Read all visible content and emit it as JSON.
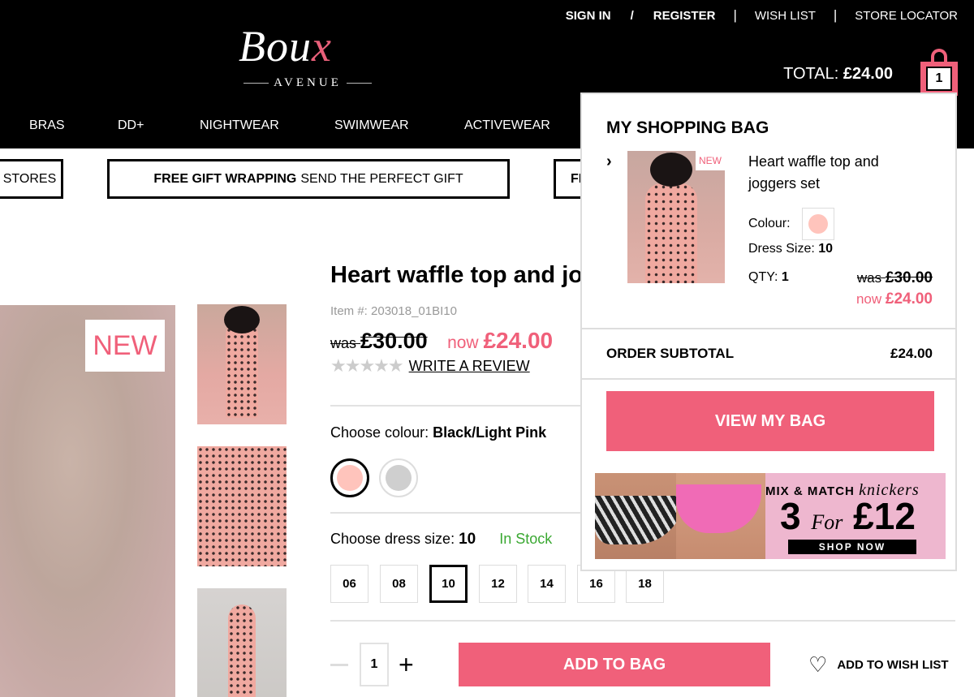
{
  "header": {
    "top_links": {
      "sign_in": "SIGN IN",
      "slash": "/",
      "register": "REGISTER",
      "sep": "|",
      "wish_list": "WISH LIST",
      "store_locator": "STORE LOCATOR"
    },
    "logo": {
      "brand": "Bou",
      "brand_x": "x",
      "sub": "AVENUE"
    },
    "total_label": "TOTAL:",
    "total_value": "£24.00",
    "bag_count": "1",
    "nav": [
      "BRAS",
      "DD+",
      "NIGHTWEAR",
      "SWIMWEAR",
      "ACTIVEWEAR"
    ]
  },
  "promos": [
    {
      "bold": "",
      "text": "STORES"
    },
    {
      "bold": "FREE GIFT WRAPPING",
      "text": "SEND THE PERFECT GIFT"
    },
    {
      "bold": "FI",
      "text": ""
    }
  ],
  "product": {
    "new_badge": "NEW",
    "title": "Heart waffle top and joggers set",
    "item_number": "Item #: 203018_01BI10",
    "was_label": "was",
    "was_price": "£30.00",
    "now_label": "now",
    "now_price": "£24.00",
    "stars": "★★★★★",
    "rating": 0,
    "review_link": "WRITE A REVIEW",
    "colour_label": "Choose colour:",
    "colour_value": "Black/Light Pink",
    "colours": [
      {
        "name": "Light Pink",
        "hex": "#ffc4bc",
        "selected": true
      },
      {
        "name": "Grey",
        "hex": "#cfcfcf",
        "selected": false
      }
    ],
    "size_label": "Choose dress size:",
    "size_value": "10",
    "stock_status": "In Stock",
    "sizes": [
      "06",
      "08",
      "10",
      "12",
      "14",
      "16",
      "18"
    ],
    "selected_size": "10",
    "quantity": "1",
    "minus": "—",
    "plus": "+",
    "add_to_bag": "ADD TO BAG",
    "wish_icon": "♡",
    "add_to_wish": "ADD TO WISH LIST"
  },
  "minibag": {
    "title": "MY SHOPPING BAG",
    "chevron": "›",
    "item": {
      "new_badge": "NEW",
      "name": "Heart waffle top and joggers set",
      "colour_label": "Colour:",
      "colour_hex": "#ffc4bc",
      "size_label": "Dress Size:",
      "size_value": "10",
      "qty_label": "QTY:",
      "qty_value": "1",
      "was_label": "was",
      "was_price": "£30.00",
      "now_label": "now",
      "now_price": "£24.00"
    },
    "subtotal_label": "ORDER SUBTOTAL",
    "subtotal_value": "£24.00",
    "view_bag": "VIEW MY BAG",
    "promo": {
      "line1": "MIX & MATCH",
      "line1_script": "knickers",
      "big_num": "3",
      "big_for": "For",
      "big_price": "£12",
      "cta": "SHOP NOW"
    }
  },
  "colors": {
    "accent": "#f0607a",
    "stock": "#3aa832",
    "header_bg": "#000000"
  }
}
